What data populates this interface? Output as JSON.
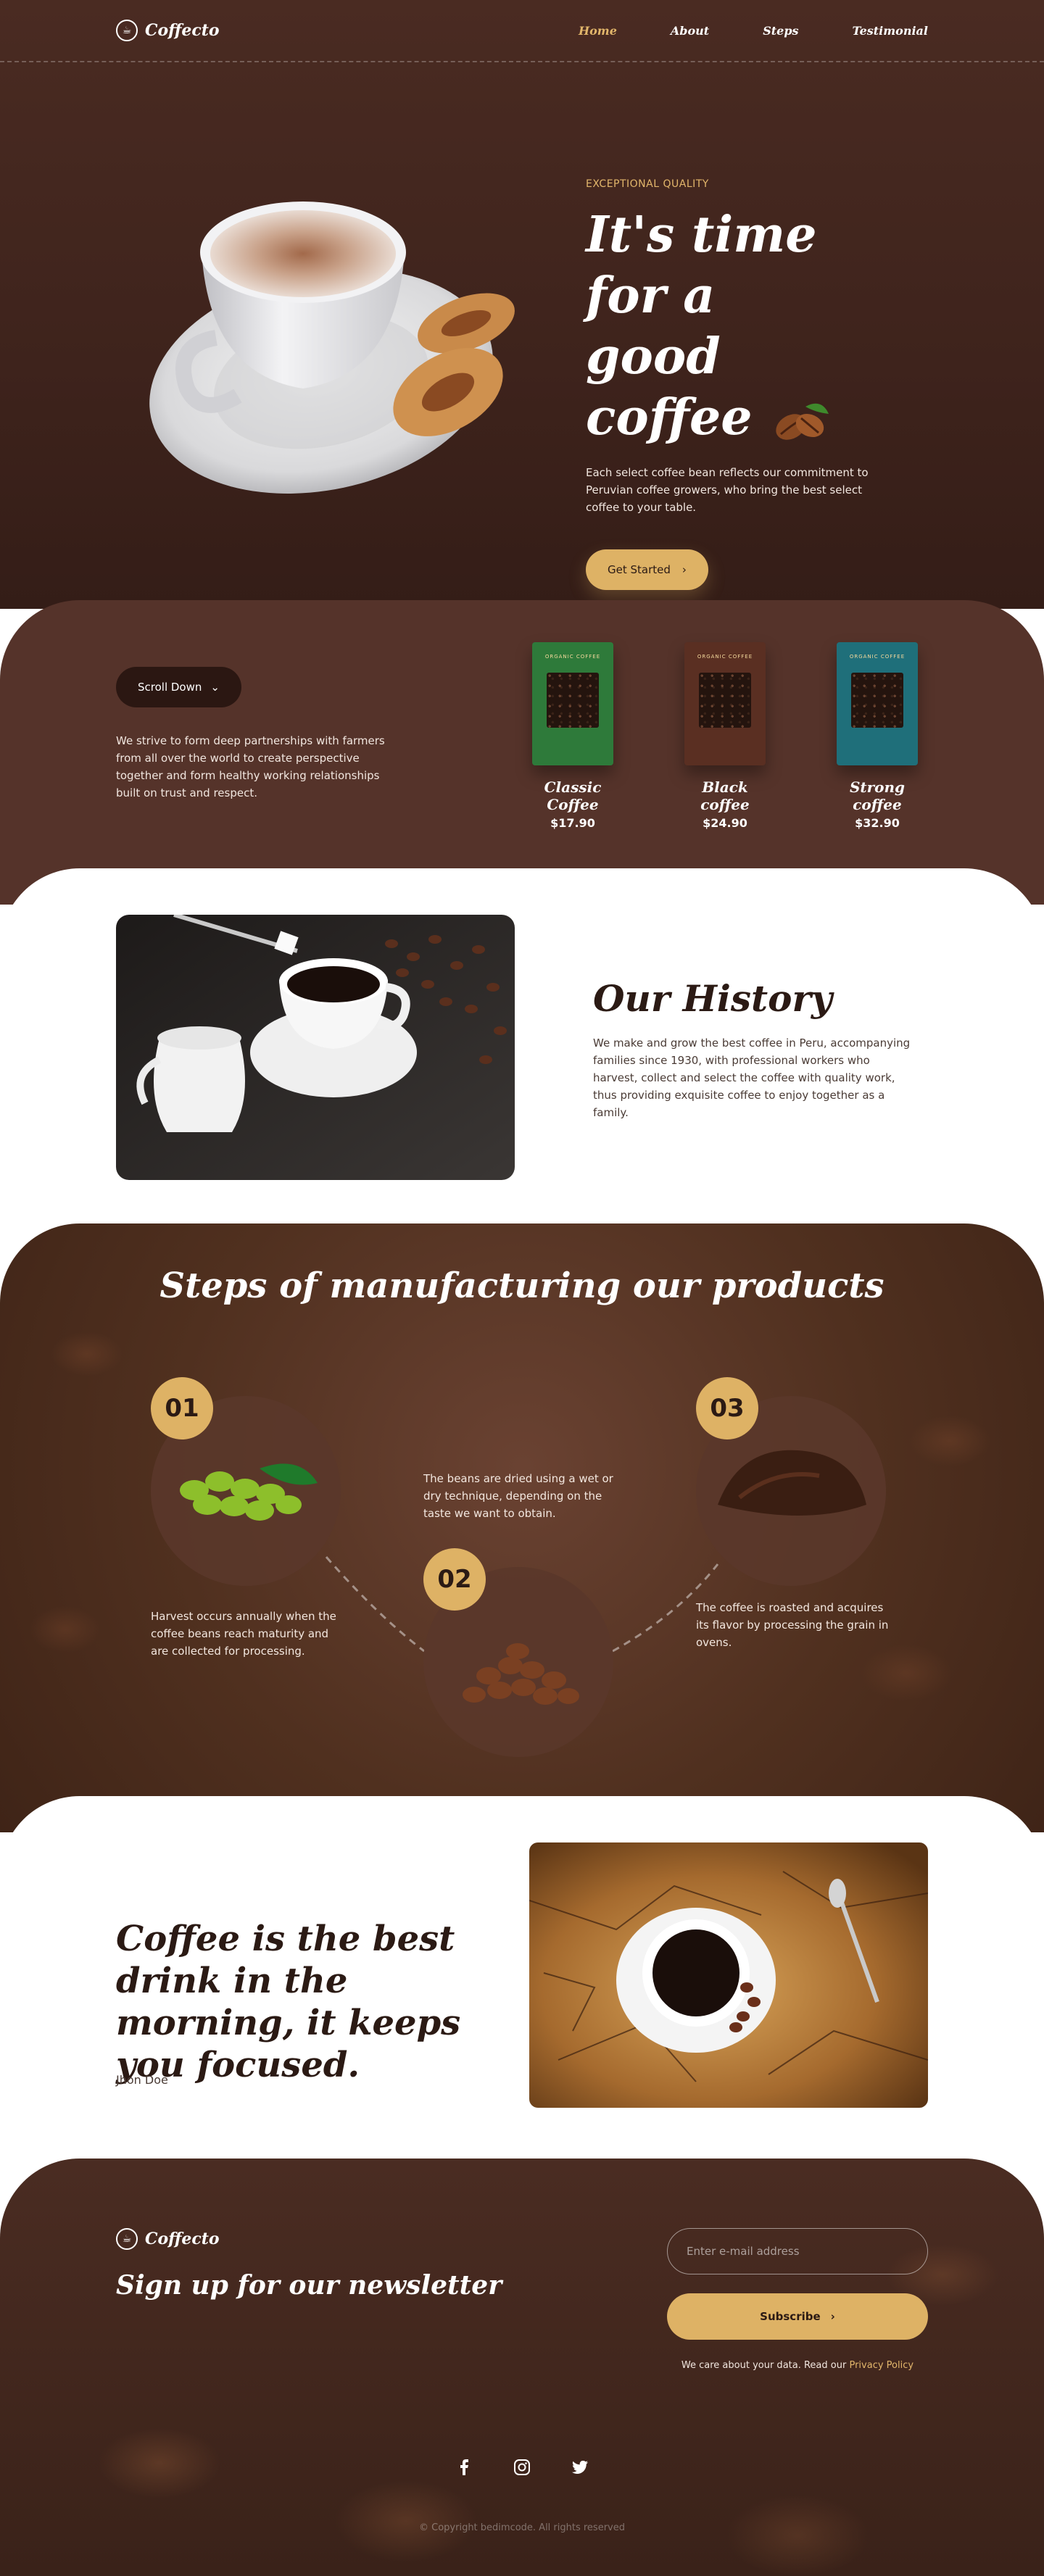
{
  "brand": {
    "name": "Coffecto"
  },
  "nav": {
    "items": [
      "Home",
      "About",
      "Steps",
      "Testimonial"
    ]
  },
  "hero": {
    "eyebrow": "EXCEPTIONAL QUALITY",
    "title_line1": "It's time for a",
    "title_line2": "good coffee",
    "description": "Each select coffee bean reflects our commitment to Peruvian coffee growers, who bring the best select coffee to your table.",
    "cta": "Get Started"
  },
  "products": {
    "scroll_label": "Scroll Down",
    "description": "We strive to form deep partnerships with farmers from all over the world to create perspective together and form healthy working relationships built on trust and respect.",
    "items": [
      {
        "name": "Classic Coffee",
        "price": "$17.90",
        "bag_color": "#2e7a3a",
        "bag_label": "ORGANIC COFFEE"
      },
      {
        "name": "Black coffee",
        "price": "$24.90",
        "bag_color": "#5a2f22",
        "bag_label": "ORGANIC COFFEE"
      },
      {
        "name": "Strong coffee",
        "price": "$32.90",
        "bag_color": "#1f6f7a",
        "bag_label": "ORGANIC COFFEE"
      }
    ]
  },
  "history": {
    "title": "Our History",
    "description": "We make and grow the best coffee in Peru, accompanying families since 1930, with professional workers who harvest, collect and select the coffee with quality work, thus providing exquisite coffee to enjoy together as a family."
  },
  "steps": {
    "title": "Steps of manufacturing our products",
    "items": [
      {
        "number": "01",
        "text": "Harvest occurs annually when the coffee beans reach maturity and are collected for processing."
      },
      {
        "number": "02",
        "text": "The beans are dried using a wet or dry technique, depending on the taste we want to obtain."
      },
      {
        "number": "03",
        "text": "The coffee is roasted and acquires its flavor by processing the grain in ovens."
      }
    ]
  },
  "quote": {
    "text": "Coffee is the best drink in the morning, it keeps you focused.",
    "author": "Jhon Doe"
  },
  "newsletter": {
    "title": "Sign up for our newsletter",
    "email_placeholder": "Enter e-mail address",
    "button": "Subscribe",
    "privacy_text": "We care about your data. Read our",
    "privacy_link": "Privacy Policy"
  },
  "footer": {
    "socials": [
      "facebook-icon",
      "instagram-icon",
      "twitter-icon"
    ],
    "copyright": "© Copyright bedimcode. All rights reserved"
  },
  "colors": {
    "accent": "#deb265",
    "dark": "#2b1a14",
    "brown": "#55332a"
  }
}
